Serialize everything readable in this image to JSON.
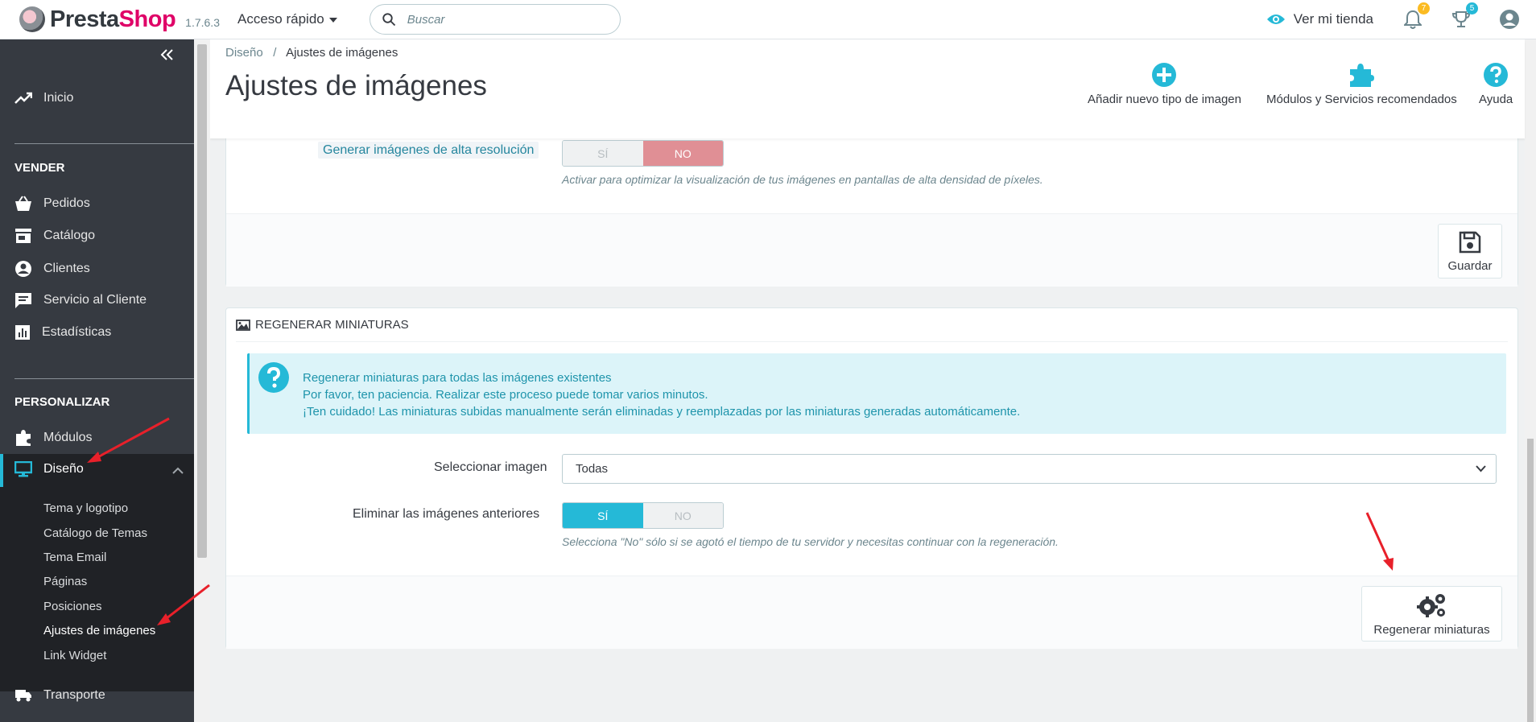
{
  "header": {
    "logo_part1": "Presta",
    "logo_part2": "Shop",
    "version": "1.7.6.3",
    "quick_access": "Acceso rápido",
    "search_placeholder": "Buscar",
    "view_store": "Ver mi tienda",
    "notifications_count": "7",
    "orders_count": "5",
    "brand_color": "#df0067",
    "accent_color": "#25b9d7"
  },
  "sidebar": {
    "home": "Inicio",
    "section_sell": "VENDER",
    "sell_items": [
      "Pedidos",
      "Catálogo",
      "Clientes",
      "Servicio al Cliente",
      "Estadísticas"
    ],
    "section_customize": "PERSONALIZAR",
    "modules": "Módulos",
    "design": "Diseño",
    "design_sub": [
      "Tema y logotipo",
      "Catálogo de Temas",
      "Tema Email",
      "Páginas",
      "Posiciones",
      "Ajustes de imágenes",
      "Link Widget"
    ],
    "shipping": "Transporte"
  },
  "page": {
    "breadcrumb_parent": "Diseño",
    "breadcrumb_sep": "/",
    "breadcrumb_current": "Ajustes de imágenes",
    "title": "Ajustes de imágenes",
    "toolbar": {
      "add_image_type": "Añadir nuevo tipo de imagen",
      "recommended": "Módulos y Servicios recomendados",
      "help": "Ayuda"
    }
  },
  "settings_panel": {
    "hires_label": "Generar imágenes de alta resolución",
    "yes": "SÍ",
    "no": "NO",
    "hires_help": "Activar para optimizar la visualización de tus imágenes en pantallas de alta densidad de píxeles.",
    "save": "Guardar"
  },
  "regen_panel": {
    "heading": "REGENERAR MINIATURAS",
    "alert_lines": [
      "Regenerar miniaturas para todas las imágenes existentes",
      "Por favor, ten paciencia. Realizar este proceso puede tomar varios minutos.",
      "¡Ten cuidado! Las miniaturas subidas manualmente serán eliminadas y reemplazadas por las miniaturas generadas automáticamente."
    ],
    "select_label": "Seleccionar imagen",
    "select_value": "Todas",
    "erase_label": "Eliminar las imágenes anteriores",
    "yes": "SÍ",
    "no": "NO",
    "erase_help": "Selecciona \"No\" sólo si se agotó el tiempo de tu servidor y necesitas continuar con la regeneración.",
    "regen_button": "Regenerar miniaturas"
  }
}
